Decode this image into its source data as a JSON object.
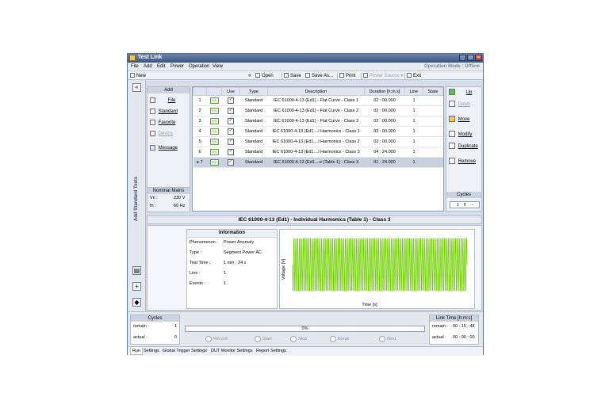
{
  "window": {
    "title": "Test Link",
    "operation_mode": "Operation Mode : Offline"
  },
  "menu": [
    "File",
    "Add",
    "Edit",
    "Power",
    "Operation",
    "View"
  ],
  "toolbar": {
    "new_label": "New",
    "open_label": "Open",
    "save_label": "Save",
    "save_as_label": "Save As...",
    "print_label": "Print",
    "power_source_label": "Power Source",
    "exit_label": "Exit"
  },
  "sidebar": {
    "vertical_label": "Add Standard Tests"
  },
  "add_panel": {
    "header": "Add",
    "items": [
      {
        "label": "File",
        "enabled": true
      },
      {
        "label": "Standard",
        "enabled": true
      },
      {
        "label": "Favorite",
        "enabled": true
      },
      {
        "label": "Device",
        "enabled": false
      },
      {
        "label": "Message",
        "enabled": true
      }
    ]
  },
  "nominal_mains": {
    "header": "Nominal Mains",
    "vn_label": "Vn :",
    "vn_value": "230 V",
    "fn_label": "fn :",
    "fn_value": "60 Hz"
  },
  "table": {
    "columns": [
      "",
      "",
      "Use",
      "Type",
      "Description",
      "Duration [h:m:s]",
      "Line",
      "State"
    ],
    "rows": [
      {
        "num": "1",
        "use": true,
        "type": "Standard",
        "description": "IEC 61000-4-13 (Ed1) - Flat Curve - Class 1",
        "duration": "02 : 00.000",
        "line": "1",
        "state": "",
        "selected": false
      },
      {
        "num": "2",
        "use": true,
        "type": "Standard",
        "description": "IEC 61000-4-13 (Ed1) - Flat Curve - Class 2",
        "duration": "02 : 00.000",
        "line": "1",
        "state": "",
        "selected": false
      },
      {
        "num": "3",
        "use": true,
        "type": "Standard",
        "description": "IEC 61000-4-13 (Ed1) - Flat Curve - Class 3",
        "duration": "02 : 00.000",
        "line": "1",
        "state": "",
        "selected": false
      },
      {
        "num": "4",
        "use": true,
        "type": "Standard",
        "description": "IEC 61000-4-13 (Ed1....l Harmonics - Class 1",
        "duration": "02 : 00.000",
        "line": "1",
        "state": "",
        "selected": false
      },
      {
        "num": "5",
        "use": true,
        "type": "Standard",
        "description": "IEC 61000-4-13 (Ed1....l Harmonics - Class 2",
        "duration": "02 : 00.000",
        "line": "1",
        "state": "",
        "selected": false
      },
      {
        "num": "6",
        "use": true,
        "type": "Standard",
        "description": "IEC 61000-4-13 (Ed1....l Harmonics - Class 3",
        "duration": "04 : 24.000",
        "line": "1",
        "state": "",
        "selected": false
      },
      {
        "num": "7",
        "use": true,
        "type": "Standard",
        "description": "IEC 61000-4-13 (Ed1....e (Table 1) - Class 3",
        "duration": "01 : 24.000",
        "line": "1",
        "state": "",
        "selected": true
      }
    ]
  },
  "right_panel": {
    "items": [
      {
        "label": "Up",
        "enabled": true
      },
      {
        "label": "Down",
        "enabled": false
      },
      {
        "label": "Move",
        "enabled": true
      },
      {
        "label": "Modify",
        "enabled": true
      },
      {
        "label": "Duplicate",
        "enabled": true
      },
      {
        "label": "Remove",
        "enabled": true
      }
    ],
    "cycles_label": "Cycles",
    "cycles_value": "1"
  },
  "detail": {
    "title": "IEC 61000-4-13 (Ed1) - Individual Harmonics (Table 1) - Class 3",
    "info_header": "Information",
    "info": [
      {
        "key": "Phenomenon :",
        "value": "Power Anomaly"
      },
      {
        "key": "Type :",
        "value": "Segment Power AC"
      },
      {
        "key": "Test Time :",
        "value": "1 min : 24 s"
      },
      {
        "key": "Line :",
        "value": "1"
      },
      {
        "key": "Events :",
        "value": "1"
      }
    ],
    "chart_ylabel": "Voltage [V]",
    "chart_xlabel": "Time [s]",
    "waveform_color": "#6fd000"
  },
  "status": {
    "cycles_header": "Cycles",
    "remain_label": "remain :",
    "remain_value": "1",
    "actual_label": "actual :",
    "actual_value": "0",
    "progress_text": "0%",
    "progress": 0,
    "buttons": [
      "Record",
      "Start",
      "Stop",
      "Break",
      "Next"
    ],
    "link_time_header": "Link Time [h:m:s]",
    "link_remain_label": "remain :",
    "link_remain_value": "00 : 15 : 48",
    "link_actual_label": "actual :",
    "link_actual_value": "00 : 00 : 00"
  },
  "tabs": [
    "Run",
    "Settings",
    "Global Trigger Settings",
    "DUT Monitor Settings",
    "Report Settings"
  ]
}
